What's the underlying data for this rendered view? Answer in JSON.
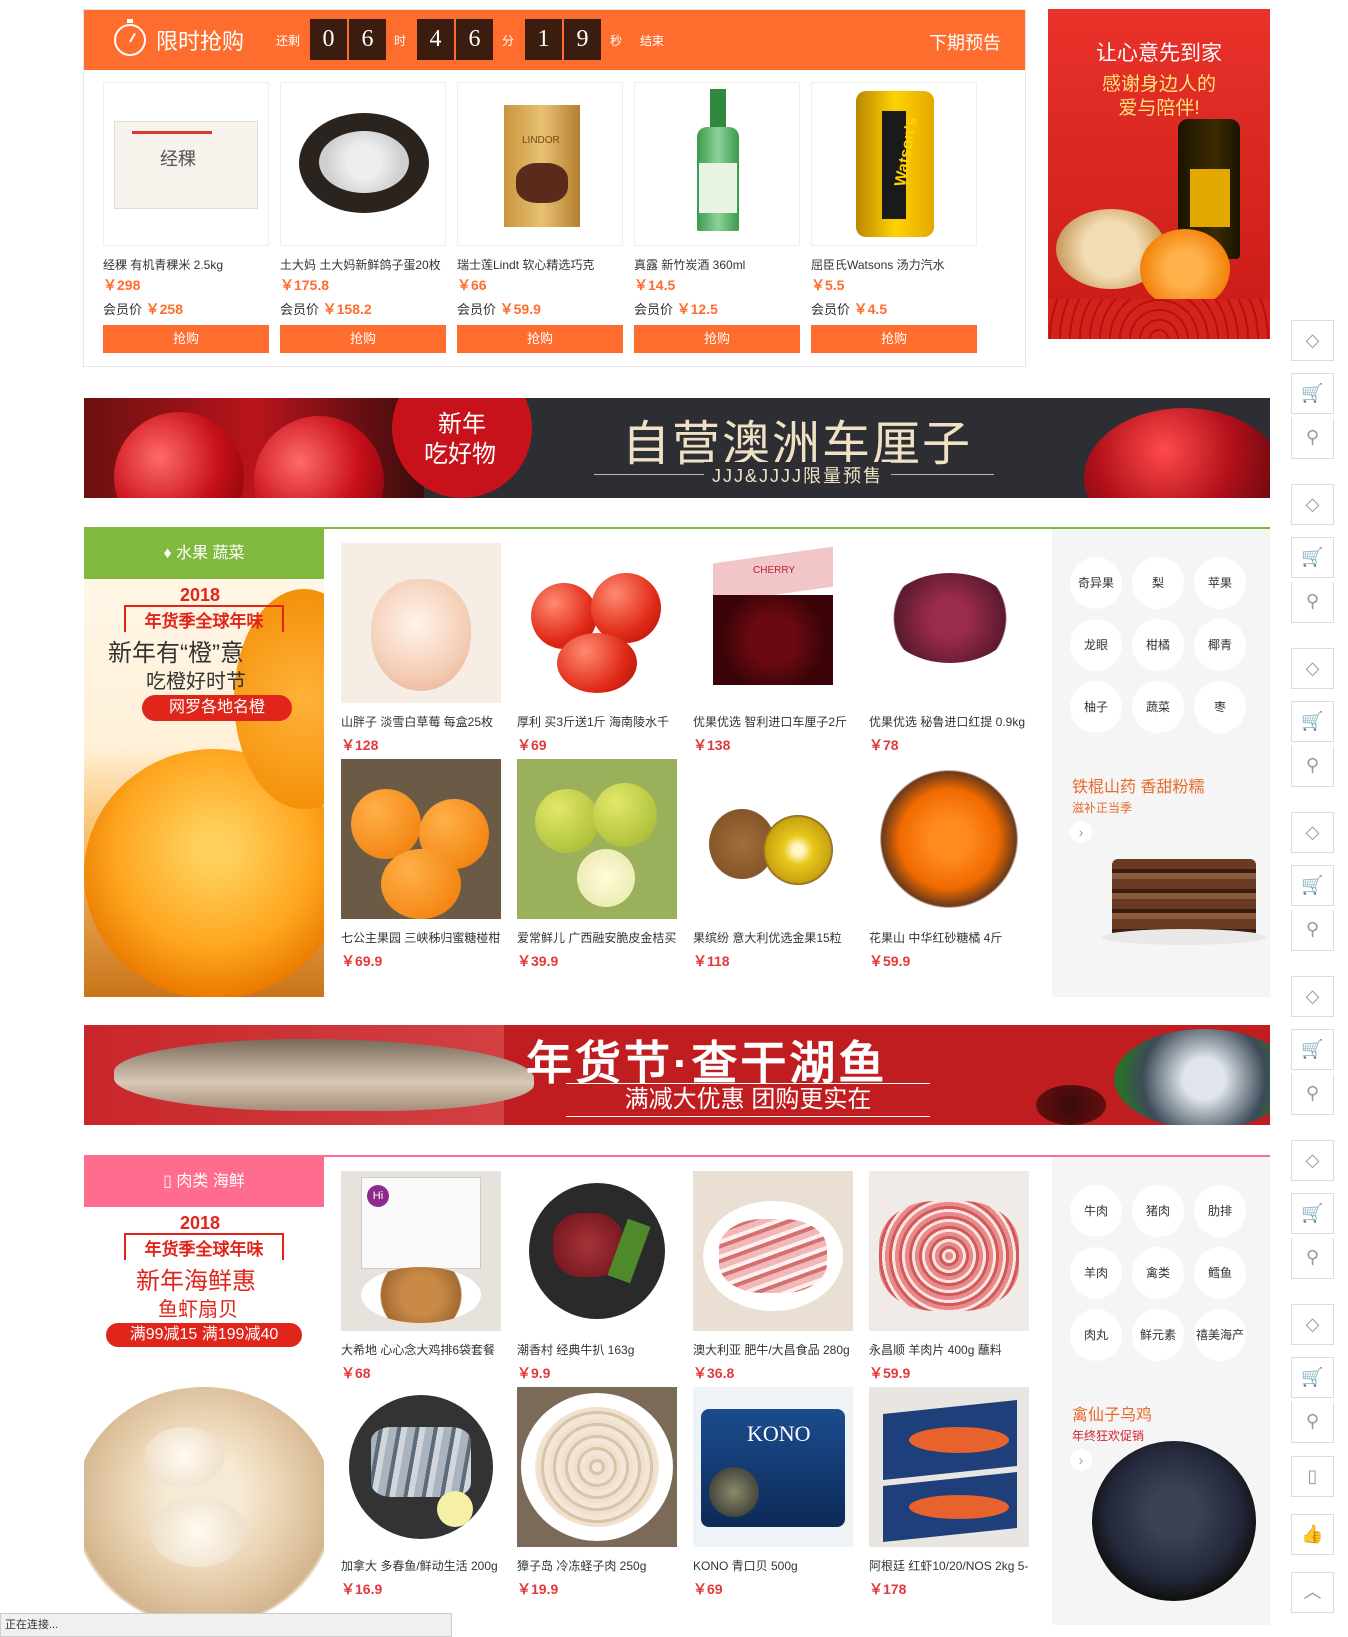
{
  "flash_sale": {
    "title": "限时抢购",
    "countdown": {
      "prefix": "还剩",
      "hours": [
        "0",
        "6"
      ],
      "hour_unit": "时",
      "minutes": [
        "4",
        "6"
      ],
      "minute_unit": "分",
      "seconds": [
        "1",
        "9"
      ],
      "second_unit": "秒",
      "suffix": "结束"
    },
    "next_preview": "下期预告",
    "items": [
      {
        "name": "经稞 有机青稞米 2.5kg",
        "price": "￥298",
        "member_label": "会员价",
        "member_price": "￥258",
        "button": "抢购"
      },
      {
        "name": "土大妈 土大妈新鲜鸽子蛋20枚",
        "price": "￥175.8",
        "member_label": "会员价",
        "member_price": "￥158.2",
        "button": "抢购"
      },
      {
        "name": "瑞士莲Lindt 软心精选巧克",
        "price": "￥66",
        "member_label": "会员价",
        "member_price": "￥59.9",
        "button": "抢购"
      },
      {
        "name": "真露 新竹炭酒 360ml",
        "price": "￥14.5",
        "member_label": "会员价",
        "member_price": "￥12.5",
        "button": "抢购"
      },
      {
        "name": "屈臣氏Watsons 汤力汽水",
        "price": "￥5.5",
        "member_label": "会员价",
        "member_price": "￥4.5",
        "button": "抢购"
      }
    ]
  },
  "side_ad": {
    "line1": "让心意先到家",
    "line2": "感谢身边人的",
    "line3": "爱与陪伴!"
  },
  "banner1": {
    "tag1": "新年",
    "tag2": "吃好物",
    "title": "自营澳洲车厘子",
    "subtitle": "JJJ&JJJJ限量预售"
  },
  "banner2": {
    "title": "年货节·查干湖鱼",
    "subtitle": "满减大优惠 团购更实在"
  },
  "section_fruit": {
    "tab": "水果 蔬菜",
    "promo": {
      "year": "2018",
      "line1": "年货季全球年味",
      "line2": "新年有“橙”意",
      "line3": "吃橙好时节",
      "line4": "网罗各地名橙"
    },
    "products": [
      {
        "name": "山胖子 淡雪白草莓 每盒25枚",
        "price": "￥128"
      },
      {
        "name": "厚利 买3斤送1斤 海南陵水千",
        "price": "￥69"
      },
      {
        "name": "优果优选 智利进口车厘子2斤",
        "price": "￥138"
      },
      {
        "name": "优果优选 秘鲁进口红提 0.9kg",
        "price": "￥78"
      },
      {
        "name": "七公主果园 三峡秭归蜜糖椪柑",
        "price": "￥69.9"
      },
      {
        "name": "爱常鲜儿 广西融安脆皮金桔买",
        "price": "￥39.9"
      },
      {
        "name": "果缤纷 意大利优选金果15粒",
        "price": "￥118"
      },
      {
        "name": "花果山 中华红砂糖橘 4斤",
        "price": "￥59.9"
      }
    ],
    "tags": [
      "奇异果",
      "梨",
      "苹果",
      "龙眼",
      "柑橘",
      "椰青",
      "柚子",
      "蔬菜",
      "枣"
    ],
    "right_promo": {
      "title": "铁棍山药 香甜粉糯",
      "sub": "滋补正当季",
      "arrow": "›"
    }
  },
  "section_meat": {
    "tab": "肉类 海鲜",
    "promo": {
      "year": "2018",
      "line1": "年货季全球年味",
      "line2": "新年海鲜惠",
      "line3": "鱼虾扇贝",
      "line4": "满99减15 满199减40"
    },
    "products": [
      {
        "name": "大希地 心心念大鸡排6袋套餐",
        "price": "￥68"
      },
      {
        "name": "潮香村 经典牛扒 163g",
        "price": "￥9.9"
      },
      {
        "name": "澳大利亚 肥牛/大昌食品 280g",
        "price": "￥36.8"
      },
      {
        "name": "永昌顺 羊肉片 400g 蘸料",
        "price": "￥59.9"
      },
      {
        "name": "加拿大 多春鱼/鲜动生活 200g",
        "price": "￥16.9"
      },
      {
        "name": "獐子岛 冷冻蛏子肉 250g",
        "price": "￥19.9"
      },
      {
        "name": "KONO 青口贝 500g",
        "price": "￥69"
      },
      {
        "name": "阿根廷 红虾10/20/NOS 2kg 5-",
        "price": "￥178"
      }
    ],
    "tags": [
      "牛肉",
      "猪肉",
      "肋排",
      "羊肉",
      "禽类",
      "鳕鱼",
      "肉丸",
      "鲜元素",
      "禧美海产"
    ],
    "right_promo": {
      "title": "禽仙子乌鸡",
      "sub": "年终狂欢促销",
      "arrow": "›"
    }
  },
  "status_bar": "正在连接..."
}
